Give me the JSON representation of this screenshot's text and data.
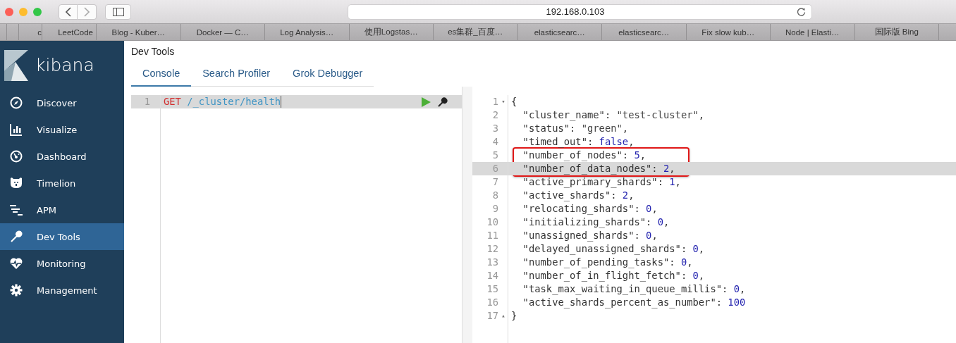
{
  "browser": {
    "address": "192.168.0.103",
    "bookmarks": [
      "c",
      "LeetCode",
      "Blog - Kuber…",
      "Docker — C…",
      "Log Analysis…",
      "使用Logstas…",
      "es集群_百度…",
      "elasticsearc…",
      "elasticsearc…",
      "Fix slow kub…",
      "Node | Elasti…",
      "国际版 Bing"
    ]
  },
  "sidebar": {
    "brand": "kibana",
    "items": [
      {
        "kind": "discover",
        "label": "Discover",
        "selected": false
      },
      {
        "kind": "visualize",
        "label": "Visualize",
        "selected": false
      },
      {
        "kind": "dashboard",
        "label": "Dashboard",
        "selected": false
      },
      {
        "kind": "timelion",
        "label": "Timelion",
        "selected": false
      },
      {
        "kind": "apm",
        "label": "APM",
        "selected": false
      },
      {
        "kind": "devtools",
        "label": "Dev Tools",
        "selected": true
      },
      {
        "kind": "monitoring",
        "label": "Monitoring",
        "selected": false
      },
      {
        "kind": "management",
        "label": "Management",
        "selected": false
      }
    ]
  },
  "page": {
    "title": "Dev Tools",
    "tabs": [
      {
        "label": "Console",
        "selected": true
      },
      {
        "label": "Search Profiler",
        "selected": false
      },
      {
        "label": "Grok Debugger",
        "selected": false
      }
    ]
  },
  "request_editor": {
    "lines": [
      {
        "number": "1",
        "active": true,
        "cursor": true,
        "tokens": [
          {
            "kind": "method",
            "text": "GET"
          },
          {
            "kind": "url",
            "text": " /_cluster/health"
          }
        ]
      }
    ]
  },
  "response_viewer": {
    "lines": [
      {
        "number": "1",
        "fold": "▾",
        "active": false,
        "boxed": false,
        "tokens": [
          {
            "kind": "punct",
            "text": "{"
          }
        ]
      },
      {
        "number": "2",
        "active": false,
        "boxed": false,
        "tokens": [
          {
            "kind": "key",
            "text": "  \"cluster_name\""
          },
          {
            "kind": "punct",
            "text": ": "
          },
          {
            "kind": "string",
            "text": "\"test-cluster\""
          },
          {
            "kind": "punct",
            "text": ","
          }
        ]
      },
      {
        "number": "3",
        "active": false,
        "boxed": false,
        "tokens": [
          {
            "kind": "key",
            "text": "  \"status\""
          },
          {
            "kind": "punct",
            "text": ": "
          },
          {
            "kind": "string",
            "text": "\"green\""
          },
          {
            "kind": "punct",
            "text": ","
          }
        ]
      },
      {
        "number": "4",
        "active": false,
        "boxed": false,
        "tokens": [
          {
            "kind": "key",
            "text": "  \"timed_out\""
          },
          {
            "kind": "punct",
            "text": ": "
          },
          {
            "kind": "literal",
            "text": "false"
          },
          {
            "kind": "punct",
            "text": ","
          }
        ]
      },
      {
        "number": "5",
        "active": false,
        "boxed": true,
        "tokens": [
          {
            "kind": "key",
            "text": "  \"number_of_nodes\""
          },
          {
            "kind": "punct",
            "text": ": "
          },
          {
            "kind": "literal",
            "text": "5"
          },
          {
            "kind": "punct",
            "text": ","
          }
        ]
      },
      {
        "number": "6",
        "active": true,
        "boxed": true,
        "tokens": [
          {
            "kind": "key",
            "text": "  \"number_of_data_nodes\""
          },
          {
            "kind": "punct",
            "text": ": "
          },
          {
            "kind": "literal",
            "text": "2"
          },
          {
            "kind": "punct",
            "text": ","
          }
        ]
      },
      {
        "number": "7",
        "active": false,
        "boxed": false,
        "tokens": [
          {
            "kind": "key",
            "text": "  \"active_primary_shards\""
          },
          {
            "kind": "punct",
            "text": ": "
          },
          {
            "kind": "literal",
            "text": "1"
          },
          {
            "kind": "punct",
            "text": ","
          }
        ]
      },
      {
        "number": "8",
        "active": false,
        "boxed": false,
        "tokens": [
          {
            "kind": "key",
            "text": "  \"active_shards\""
          },
          {
            "kind": "punct",
            "text": ": "
          },
          {
            "kind": "literal",
            "text": "2"
          },
          {
            "kind": "punct",
            "text": ","
          }
        ]
      },
      {
        "number": "9",
        "active": false,
        "boxed": false,
        "tokens": [
          {
            "kind": "key",
            "text": "  \"relocating_shards\""
          },
          {
            "kind": "punct",
            "text": ": "
          },
          {
            "kind": "literal",
            "text": "0"
          },
          {
            "kind": "punct",
            "text": ","
          }
        ]
      },
      {
        "number": "10",
        "active": false,
        "boxed": false,
        "tokens": [
          {
            "kind": "key",
            "text": "  \"initializing_shards\""
          },
          {
            "kind": "punct",
            "text": ": "
          },
          {
            "kind": "literal",
            "text": "0"
          },
          {
            "kind": "punct",
            "text": ","
          }
        ]
      },
      {
        "number": "11",
        "active": false,
        "boxed": false,
        "tokens": [
          {
            "kind": "key",
            "text": "  \"unassigned_shards\""
          },
          {
            "kind": "punct",
            "text": ": "
          },
          {
            "kind": "literal",
            "text": "0"
          },
          {
            "kind": "punct",
            "text": ","
          }
        ]
      },
      {
        "number": "12",
        "active": false,
        "boxed": false,
        "tokens": [
          {
            "kind": "key",
            "text": "  \"delayed_unassigned_shards\""
          },
          {
            "kind": "punct",
            "text": ": "
          },
          {
            "kind": "literal",
            "text": "0"
          },
          {
            "kind": "punct",
            "text": ","
          }
        ]
      },
      {
        "number": "13",
        "active": false,
        "boxed": false,
        "tokens": [
          {
            "kind": "key",
            "text": "  \"number_of_pending_tasks\""
          },
          {
            "kind": "punct",
            "text": ": "
          },
          {
            "kind": "literal",
            "text": "0"
          },
          {
            "kind": "punct",
            "text": ","
          }
        ]
      },
      {
        "number": "14",
        "active": false,
        "boxed": false,
        "tokens": [
          {
            "kind": "key",
            "text": "  \"number_of_in_flight_fetch\""
          },
          {
            "kind": "punct",
            "text": ": "
          },
          {
            "kind": "literal",
            "text": "0"
          },
          {
            "kind": "punct",
            "text": ","
          }
        ]
      },
      {
        "number": "15",
        "active": false,
        "boxed": false,
        "tokens": [
          {
            "kind": "key",
            "text": "  \"task_max_waiting_in_queue_millis\""
          },
          {
            "kind": "punct",
            "text": ": "
          },
          {
            "kind": "literal",
            "text": "0"
          },
          {
            "kind": "punct",
            "text": ","
          }
        ]
      },
      {
        "number": "16",
        "active": false,
        "boxed": false,
        "tokens": [
          {
            "kind": "key",
            "text": "  \"active_shards_percent_as_number\""
          },
          {
            "kind": "punct",
            "text": ": "
          },
          {
            "kind": "literal",
            "text": "100"
          }
        ]
      },
      {
        "number": "17",
        "fold": "▴",
        "active": false,
        "boxed": false,
        "tokens": [
          {
            "kind": "punct",
            "text": "}"
          }
        ]
      }
    ]
  }
}
